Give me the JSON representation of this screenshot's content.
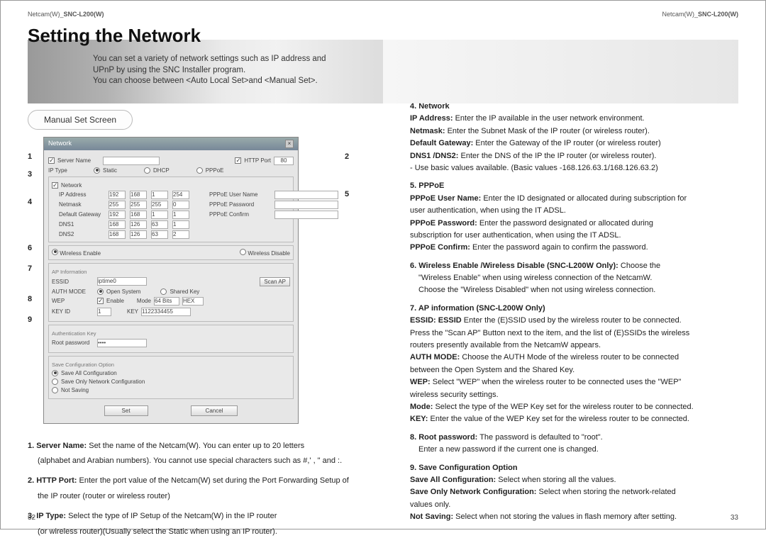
{
  "header": {
    "brand": "Netcam(W)_",
    "model": "SNC-L200(W)"
  },
  "title": "Setting the Network",
  "subtitle_l1": "You can set a variety of network settings such as IP address and",
  "subtitle_l2": "UPnP by using the SNC Installer program.",
  "subtitle_l3": "You can choose between <Auto Local Set>and <Manual Set>.",
  "manual_label": "Manual Set Screen",
  "inst_left": {
    "i1a": "1. Server Name:",
    "i1b": " Set the name of the Netcam(W). You can enter up to 20 letters",
    "i1c": "(alphabet and Arabian numbers). You cannot use special characters such as #,' , \" and :.",
    "i2a": "2. HTTP Port:",
    "i2b": " Enter the port value of the Netcam(W) set during the Port Forwarding Setup of",
    "i2c": "the IP router (router or wireless router)",
    "i3a": "3. IP Type:",
    "i3b": " Select the type of IP Setup of the Netcam(W) in the IP router",
    "i3c": "(or wireless router)(Usually select the Static when using an IP router)."
  },
  "r": {
    "h4": "4. Network",
    "n_ip": [
      "IP Address:",
      " Enter the IP available in the user network environment."
    ],
    "n_nm": [
      "Netmask:",
      " Enter the Subnet Mask of the IP router (or wireless router)."
    ],
    "n_gw": [
      "Default Gateway:",
      " Enter the Gateway of the IP router (or wireless router)"
    ],
    "n_dns": [
      "DNS1 /DNS2:",
      " Enter the DNS of the IP the IP router (or wireless router)."
    ],
    "n_basic": "- Use basic values available. (Basic values -168.126.63.1/168.126.63.2)",
    "h5": "5. PPPoE",
    "p_un1": [
      "PPPoE User Name:",
      " Enter the ID designated or allocated during subscription for"
    ],
    "p_un2": "user authentication, when using the IT ADSL.",
    "p_pw1": [
      "PPPoE Password:",
      " Enter the password designated or allocated during"
    ],
    "p_pw2": "subscription for user authentication, when using the IT ADSL.",
    "p_cf": [
      "PPPoE Confirm:",
      " Enter the password again to confirm the password."
    ],
    "h6": [
      "6. Wireless Enable /Wireless Disable (SNC-L200W Only):",
      " Choose the"
    ],
    "h6b": "\"Wireless Enable\" when using wireless connection of the NetcamW.",
    "h6c": "Choose the \"Wireless Disabled\" when not using wireless connection.",
    "h7": "7. AP information (SNC-L200W Only)",
    "a_es1": [
      "ESSID: ESSID",
      " Enter the (E)SSID used by the wireless router to be connected."
    ],
    "a_es2": "Press the \"Scan AP\" Button next to the item, and the list of (E)SSIDs the wireless",
    "a_es3": "routers presently available from the NetcamW appears.",
    "a_am1": [
      "AUTH MODE:",
      " Choose the AUTH Mode of the wireless router to be connected"
    ],
    "a_am2": "between the Open System and the Shared Key.",
    "a_wep1": [
      "WEP:",
      " Select \"WEP\" when the wireless router to be connected uses the \"WEP\""
    ],
    "a_wep2": "wireless security settings.",
    "a_mode": [
      "Mode:",
      " Select the type of the WEP Key set for the wireless router to be connected."
    ],
    "a_key": [
      "KEY:",
      " Enter the value of the WEP Key set for the wireless router to be connected."
    ],
    "h8": [
      "8. Root password:",
      " The password is defaulted to \"root\"."
    ],
    "h8b": "Enter a new password if the current one is changed.",
    "h9": "9. Save Configuration Option",
    "sc_all": [
      "Save All Configuration:",
      " Select when storing all the values."
    ],
    "sc_only1": [
      "Save Only Network Configuration:",
      " Select when storing the network-related"
    ],
    "sc_only2": "values only.",
    "sc_not": [
      "Not Saving:",
      " Select when not storing the values in flash memory after setting."
    ]
  },
  "pg": {
    "left": "32",
    "right": "33"
  },
  "shot": {
    "title": "Network",
    "server_name": "Server Name",
    "http_port": "HTTP Port",
    "http_val": "80",
    "ip_type": "IP Type",
    "static": "Static",
    "dhcp": "DHCP",
    "pppoe": "PPPoE",
    "network": "Network",
    "ip_addr": "IP Address",
    "ip_v": [
      "192",
      "168",
      "1",
      "254"
    ],
    "netmask": "Netmask",
    "nm_v": [
      "255",
      "255",
      "255",
      "0"
    ],
    "gateway": "Default Gateway",
    "gw_v": [
      "192",
      "168",
      "1",
      "1"
    ],
    "dns1": "DNS1",
    "d1_v": [
      "168",
      "126",
      "63",
      "1"
    ],
    "dns2": "DNS2",
    "d2_v": [
      "168",
      "126",
      "63",
      "2"
    ],
    "pun": "PPPoE User Name",
    "ppw": "PPPoE Password",
    "pcf": "PPPoE Confirm",
    "wen": "Wireless Enable",
    "wdis": "Wireless Disable",
    "apinfo": "AP Information",
    "essid": "ESSID",
    "essid_v": "iptime0",
    "scan": "Scan AP",
    "auth": "AUTH MODE",
    "open": "Open System",
    "shared": "Shared Key",
    "wep": "WEP",
    "enable": "Enable",
    "mode": "Mode",
    "m64": "64 Bits",
    "hex": "HEX",
    "keyid": "KEY ID",
    "k1": "1",
    "key": "KEY",
    "key_v": "1122334455",
    "authkey": "Authentication Key",
    "rootpw": "Root password",
    "sco": "Save Configuration Option",
    "sall": "Save All Configuration",
    "sonly": "Save Only Network Configuration",
    "snot": "Not Saving",
    "set": "Set",
    "cancel": "Cancel"
  }
}
